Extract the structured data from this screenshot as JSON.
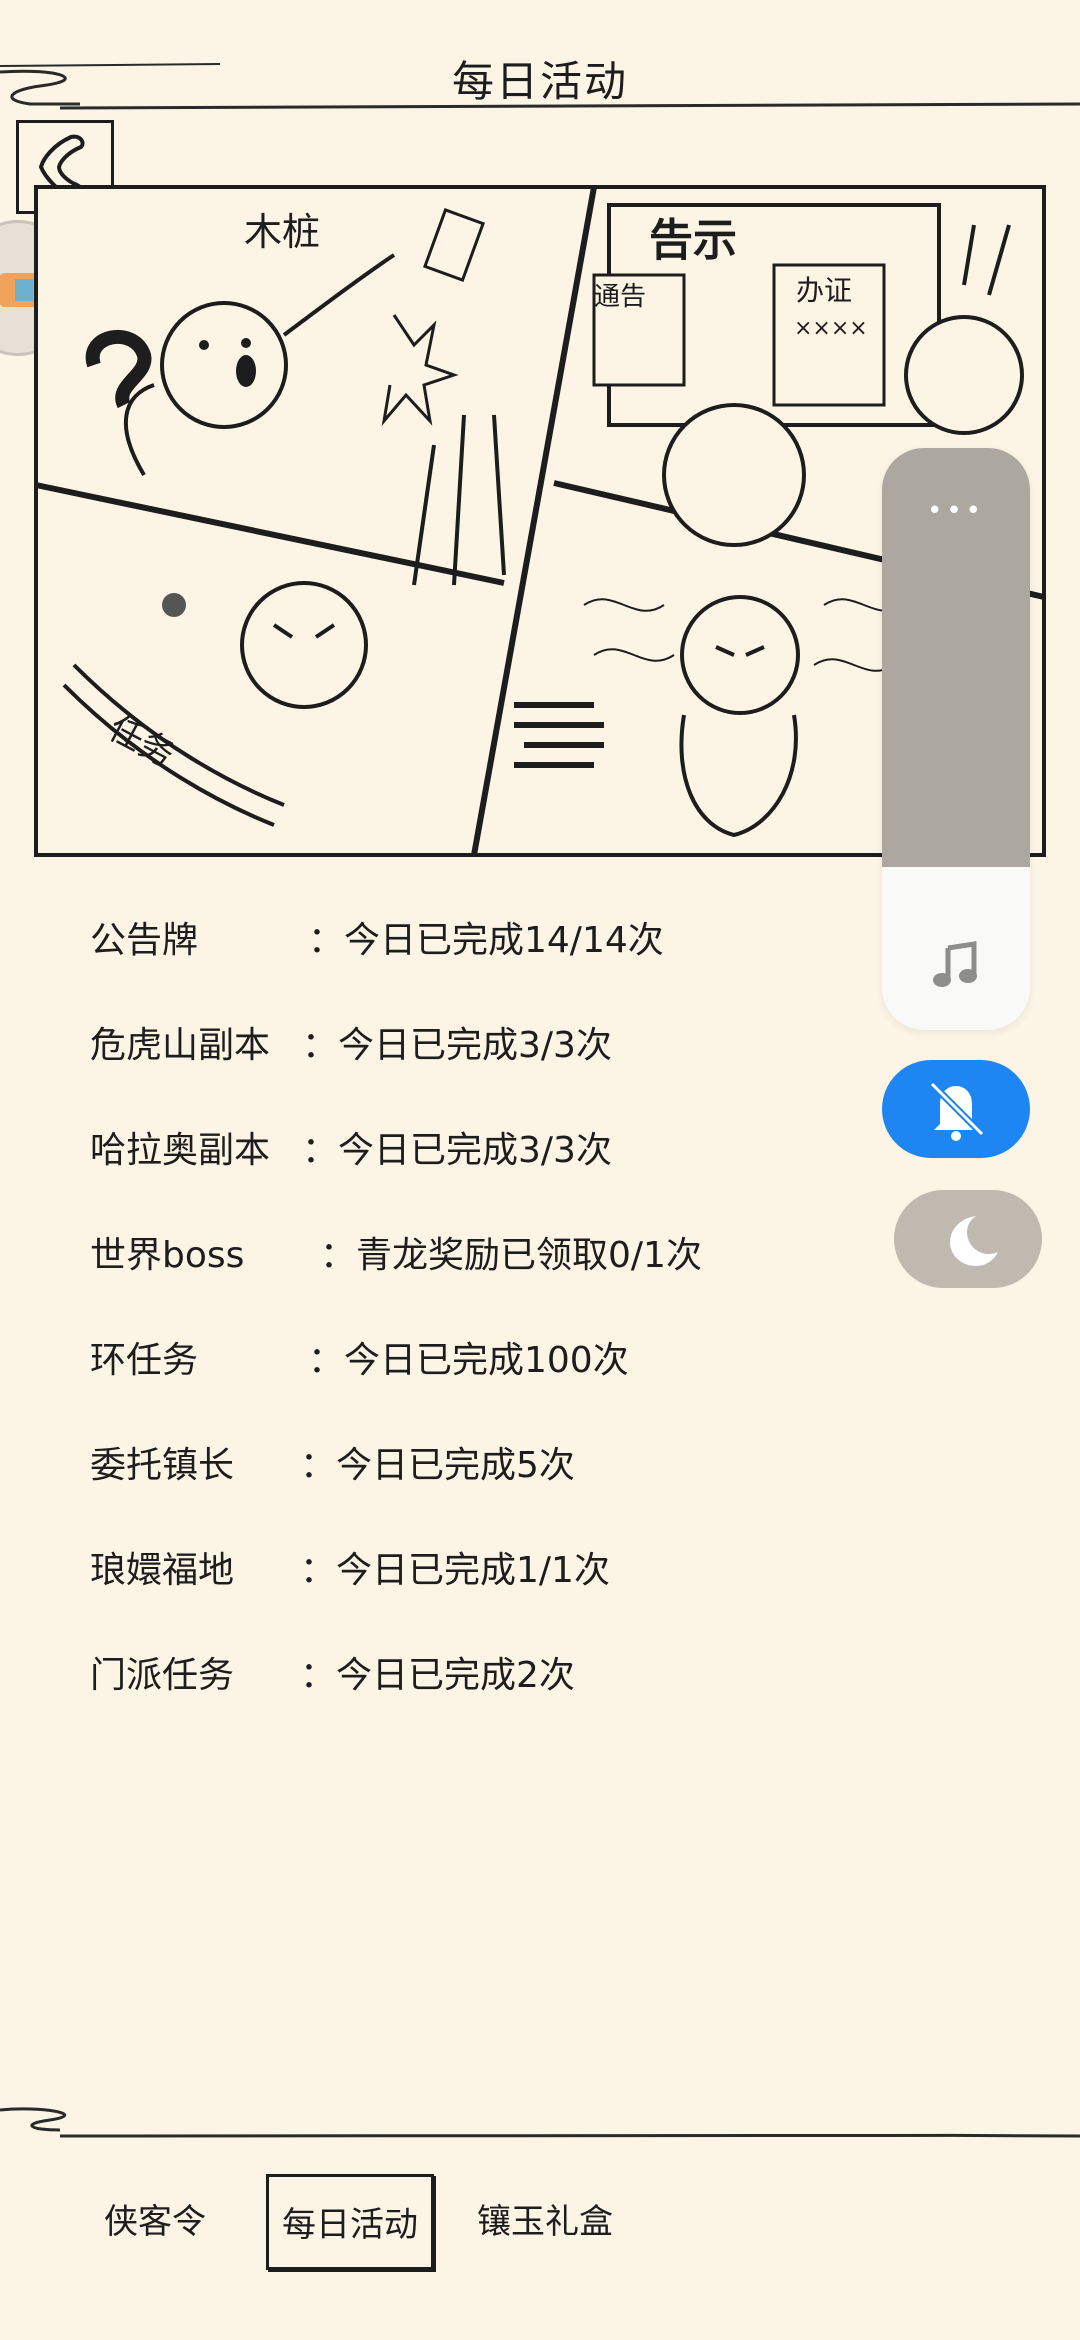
{
  "header": {
    "title": "每日活动"
  },
  "activities": [
    {
      "name": "公告牌",
      "value": "：今日已完成14/14次"
    },
    {
      "name": "危虎山副本",
      "value": "：今日已完成3/3次"
    },
    {
      "name": "哈拉奥副本",
      "value": "：今日已完成3/3次"
    },
    {
      "name": "世界boss",
      "value": "：青龙奖励已领取0/1次"
    },
    {
      "name": "环任务",
      "value": "：今日已完成100次"
    },
    {
      "name": "委托镇长",
      "value": "：今日已完成5次"
    },
    {
      "name": "琅嬛福地",
      "value": "：今日已完成1/1次"
    },
    {
      "name": "门派任务",
      "value": "：今日已完成2次"
    }
  ],
  "comic": {
    "stake_label": "木桩",
    "notice_title": "告示",
    "notice_left": "通告",
    "notice_right": "办证",
    "notice_marks": "××××",
    "scroll_label": "任务"
  },
  "tabs": [
    {
      "label": "侠客令",
      "active": false
    },
    {
      "label": "每日活动",
      "active": true
    },
    {
      "label": "镶玉礼盒",
      "active": false
    }
  ],
  "overlay": {
    "volume_level": 0.72,
    "dots": "•••",
    "mute_color": "#1d86f2",
    "panel_fill_color": "#aca89f"
  }
}
